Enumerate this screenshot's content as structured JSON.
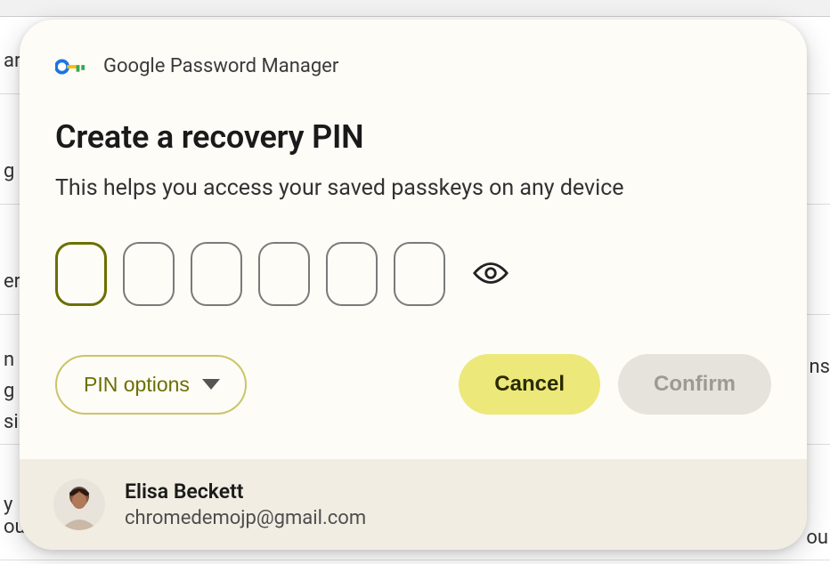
{
  "app": {
    "name": "Google Password Manager"
  },
  "dialog": {
    "title": "Create a recovery PIN",
    "subtitle": "This helps you access your saved passkeys on any device",
    "pin_length": 6,
    "pin_options_label": "PIN options",
    "cancel_label": "Cancel",
    "confirm_label": "Confirm",
    "confirm_enabled": false
  },
  "user": {
    "name": "Elisa Beckett",
    "email": "chromedemojp@gmail.com"
  },
  "background": {
    "r1": "ar",
    "r2": "g",
    "r3": "er",
    "r4a": "n i",
    "r4b": "g",
    "r4c": "si",
    "r5a": "  y",
    "r5b": "ou",
    "r5_right": "ou",
    "r6": "ns"
  }
}
